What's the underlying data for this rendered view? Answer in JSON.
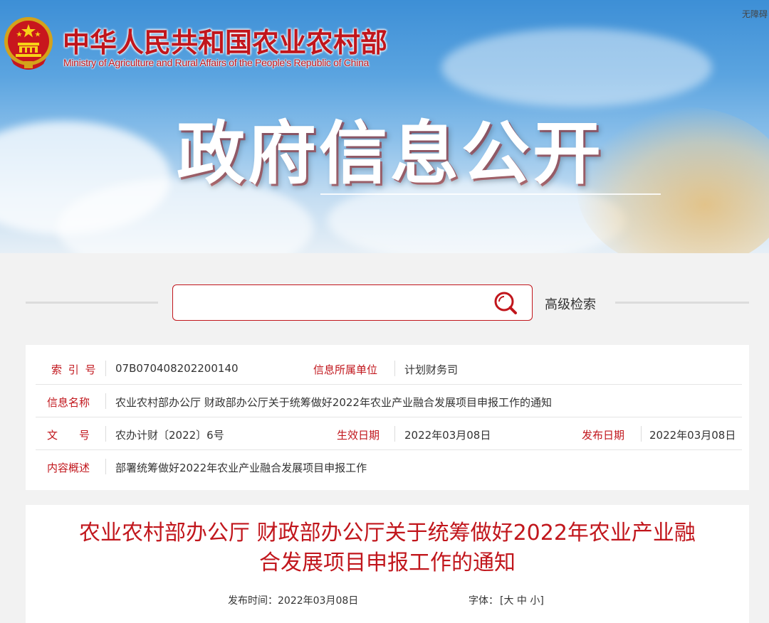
{
  "header": {
    "accessibility_link": "无障碍",
    "ministry_name_cn": "中华人民共和国农业农村部",
    "ministry_name_en": "Ministry of Agriculture and Rural Affairs of the People's Republic of China",
    "section_title": "政府信息公开"
  },
  "search": {
    "placeholder": "",
    "advanced_label": "高级检索"
  },
  "info": {
    "index_label": "索 引 号",
    "index_value": "07B070408202200140",
    "unit_label": "信息所属单位",
    "unit_value": "计划财务司",
    "name_label": "信息名称",
    "name_value": "农业农村部办公厅 财政部办公厅关于统筹做好2022年农业产业融合发展项目申报工作的通知",
    "doc_no_label": "文　　号",
    "doc_no_value": "农办计财〔2022〕6号",
    "effective_label": "生效日期",
    "effective_value": "2022年03月08日",
    "publish_label": "发布日期",
    "publish_value": "2022年03月08日",
    "summary_label": "内容概述",
    "summary_value": "部署统筹做好2022年农业产业融合发展项目申报工作"
  },
  "article": {
    "title_line1": "农业农村部办公厅 财政部办公厅关于统筹做好2022年农业产业融",
    "title_line2": "合发展项目申报工作的通知",
    "publish_time": "发布时间：2022年03月08日",
    "font_size_label": "字体：",
    "font_size_options": "[大 中 小]"
  },
  "colors": {
    "accent": "#c1161c",
    "text": "#333333",
    "page_bg": "#f2f2f2"
  },
  "icons": {
    "emblem": "national-emblem-icon",
    "search": "search-icon"
  }
}
